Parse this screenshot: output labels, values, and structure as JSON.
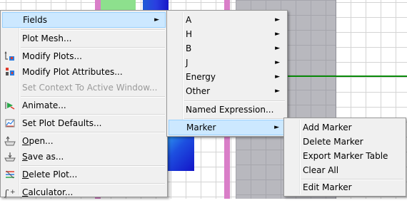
{
  "colors": {
    "menu_bg": "#f0f0f0",
    "highlight": "#cce8ff",
    "highlight_border": "#99d1ff",
    "disabled_text": "#9a9a9a",
    "pink_frame": "#d97ec8",
    "green_line": "#0a8a0a"
  },
  "main_menu": {
    "fields": "Fields",
    "plot_mesh": "Plot Mesh...",
    "modify_plots": "Modify Plots...",
    "modify_plot_attributes": "Modify Plot Attributes...",
    "set_context": "Set Context To Active Window...",
    "animate": "Animate...",
    "set_plot_defaults": "Set Plot Defaults...",
    "open": "Open...",
    "save_as": "Save as...",
    "delete_plot": "Delete Plot...",
    "calculator": "Calculator..."
  },
  "fields_menu": {
    "a": "A",
    "h": "H",
    "b": "B",
    "j": "J",
    "energy": "Energy",
    "other": "Other",
    "named_expression": "Named Expression...",
    "marker": "Marker"
  },
  "marker_menu": {
    "add_marker": "Add Marker",
    "delete_marker": "Delete Marker",
    "export_marker_table": "Export Marker Table",
    "clear_all": "Clear All",
    "edit_marker": "Edit Marker"
  },
  "icons": {
    "modify_plots": "modify-plots-icon",
    "modify_plot_attributes": "plot-attributes-icon",
    "animate": "animate-icon",
    "set_plot_defaults": "plot-defaults-icon",
    "open": "open-plot-icon",
    "save_as": "save-plot-icon",
    "delete_plot": "delete-plot-icon",
    "calculator": "calculator-icon",
    "submenu": "submenu-arrow-icon"
  }
}
